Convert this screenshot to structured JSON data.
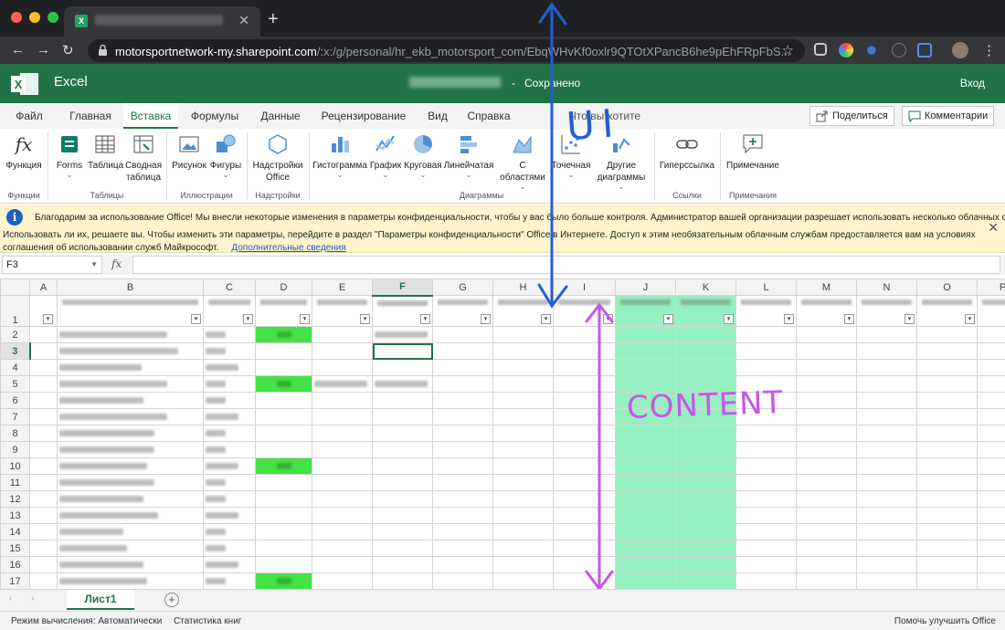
{
  "browser": {
    "tab_title": "Работа на демосайте",
    "url_host": "motorsportnetwork-my.sharepoint.com",
    "url_path": "/:x:/g/personal/hr_ekb_motorsport_com/EbqWHvKf0oxlr9QTOtXPancB6he9pEhFRpFbS..."
  },
  "app": {
    "name": "Excel",
    "doc_title": "Работа на демосайте",
    "doc_state": "Сохранено",
    "signin": "Вход"
  },
  "ribbon_tabs": [
    "Файл",
    "Главная",
    "Вставка",
    "Формулы",
    "Данные",
    "Рецензирование",
    "Вид",
    "Справка",
    "Что вы хотите сделать?"
  ],
  "share_label": "Поделиться",
  "comments_label": "Комментарии",
  "ribbon": {
    "functions": "Функция",
    "forms": "Forms",
    "table": "Таблица",
    "pivot": "Сводная таблица",
    "picture": "Рисунок",
    "shapes": "Фигуры",
    "addins": "Надстройки Office",
    "histogram": "Гистограмма",
    "graph": "График",
    "pie": "Круговая",
    "bar": "Линейчатая",
    "area": "С областями",
    "scatter": "Точечная",
    "other": "Другие диаграммы",
    "hyperlink": "Гиперссылка",
    "note": "Примечание",
    "groups": {
      "functions": "Функции",
      "tables": "Таблицы",
      "illustrations": "Иллюстрации",
      "addins": "Надстройки",
      "charts": "Диаграммы",
      "links": "Ссылки",
      "notes": "Примечания"
    }
  },
  "notification": {
    "line1": "Благодарим за использование Office! Мы внесли некоторые изменения в параметры конфиденциальности, чтобы у вас было больше контроля. Администратор вашей организации разрешает использовать несколько облачных служб.",
    "line2": "Использовать ли их, решаете вы. Чтобы изменить эти параметры, перейдите в раздел \"Параметры конфиденциальности\" Office в Интернете. Доступ к этим необязательным облачным службам предоставляется вам на условиях соглашения об использовании служб Майкрософт.",
    "more": "Дополнительные сведения"
  },
  "formula_bar": {
    "name_box": "F3",
    "fx": "fx"
  },
  "grid": {
    "columns": [
      "A",
      "B",
      "C",
      "D",
      "E",
      "F",
      "G",
      "H",
      "I",
      "J",
      "K",
      "L",
      "M",
      "N",
      "O",
      "P"
    ],
    "selected_column": "F",
    "rows": [
      "1",
      "2",
      "3",
      "4",
      "5",
      "6",
      "7",
      "8",
      "9",
      "10",
      "11",
      "12",
      "13",
      "14",
      "15",
      "16",
      "17"
    ],
    "selected_row": "3"
  },
  "annotations": {
    "ui": "UI",
    "content": "CONTENT"
  },
  "sheet": {
    "tab": "Лист1"
  },
  "status": {
    "calc_mode": "Режим вычисления: Автоматически",
    "stats": "Статистика книг",
    "improve": "Помочь улучшить Office"
  },
  "colors": {
    "excel_green": "#217346",
    "ui_annotation": "#1f5fd6",
    "content_annotation": "#c657e6",
    "highlight_yes": "#44e244",
    "highlight_mint": "#95f0c0"
  }
}
